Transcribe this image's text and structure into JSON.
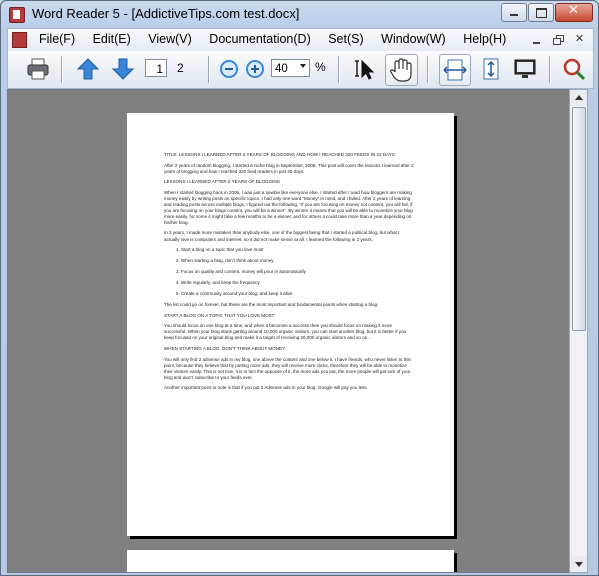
{
  "window": {
    "title": "Word Reader 5 - [AddictiveTips.com test.docx]",
    "title_buttons": [
      "minimize-icon",
      "maximize-icon",
      "close-icon"
    ]
  },
  "menu": {
    "items": [
      "File(F)",
      "Edit(E)",
      "View(V)",
      "Documentation(D)",
      "Set(S)",
      "Window(W)",
      "Help(H)"
    ],
    "mdi_buttons": [
      "minimize-icon",
      "restore-icon",
      "close-icon"
    ]
  },
  "toolbar": {
    "current_page": "1",
    "total_pages": "2",
    "zoom_value": "40",
    "zoom_unit": "%",
    "icons": [
      "printer-icon",
      "arrow-up-icon",
      "arrow-down-icon",
      "zoom-out-icon",
      "zoom-in-icon",
      "text-select-icon",
      "hand-icon",
      "fit-width-icon",
      "fit-page-icon",
      "fullscreen-icon",
      "magnifier-icon"
    ],
    "colors": {
      "arrow": "#3a86d8",
      "magnifier_rim": "#c0392b",
      "zoom_buttons": "#3a86d8"
    }
  },
  "document": {
    "title": "TITLE: LESSONS I LEARNED AFTER 2 YEARS OF BLOGGING AND HOW I REACHED 320 FEEDS IN 32 DAYS",
    "intro": "After 2 years of random blogging, I started a niche blog in September, 2008. This post will cover the lessons I learned after 2 years of blogging and how I reached 320 feed readers in just 30 days.",
    "heading1": "LESSONS I LEARNED AFTER 2 YEARS OF BLOGGING",
    "para1": "When I started blogging back in 2006, I was just a newbie like everyone else. I started after I read how bloggers are making money easily by writing posts on specific topics. I had only one word “Money” in mind, and I failed. After 2 years of learning and reading posts across multiple blogs, I figured out the following, “If you are focusing on money not content, you will fail, if you are focusing on your blogs content, you will be a winner”. By winner it means that you will be able to monetize your blog more easily, for some it might take a few months to be a winner, and for others it could take more than a year depending on his/her blog.",
    "para2": "In 2 years, I made more mistakes than anybody else, one of the biggest being that I started a political blog, but what I actually love is computers and internet, so it did not make sense at all. I learned the following in 2 years,",
    "list": [
      "Start a blog on a topic that you love most",
      "When starting a blog, don’t think about money",
      "Focus on quality and content, money will pour in automatically",
      "Write regularly, and keep the frequency",
      "Create a community around your blog, and keep it alive"
    ],
    "para3": "The list could go on forever, but these are the most important and fundamental points when starting a blog.",
    "heading2": "START A BLOG ON A TOPIC THAT YOU LOVE MOST",
    "para4": "You should focus on one blog at a time, and when it becomes a success then you should focus on making it more successful. When your blog starts getting around 10,000 organic visitors, you can start another blog, but it is better if you keep focused on your original blog and make it a target of receiving 20,000 organic visitors and so on...",
    "heading3": "WHEN STARTING A BLOG, DON’T THINK ABOUT MONEY",
    "para5": "You will only find 2 adsense ads in my blog, one above the content and one below it. I have friends, who never listen to this point, because they believe that by putting more ads, they will receive more clicks, therefore they will be able to monetize their visitors easily. This is not true, it is in fact the opposite of it, the more ads you put, the more people will get sick of your blog and won’t subscribe to your feeds ever.",
    "para6": "Another important point to note is that if you put 3 Adsense ads in your blog, Google will pay you less"
  }
}
